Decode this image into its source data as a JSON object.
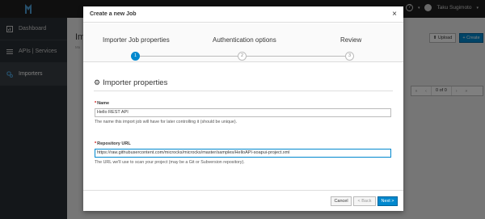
{
  "topbar": {
    "help": "?",
    "user": "Taku Sugimoto"
  },
  "sidebar": {
    "items": [
      {
        "label": "Dashboard"
      },
      {
        "label": "APIs | Services"
      },
      {
        "label": "Importers"
      }
    ]
  },
  "background": {
    "title": "Im",
    "subtitle": "Ma",
    "upload_label": "Upload",
    "create_label": "+ Create",
    "pager_count": "0 of 0"
  },
  "modal": {
    "title": "Create a new Job",
    "close": "×",
    "steps": [
      {
        "label": "Importer Job properties",
        "number": "1"
      },
      {
        "label": "Authentication options",
        "number": "2"
      },
      {
        "label": "Review",
        "number": "3"
      }
    ],
    "section_title": "Importer properties",
    "name": {
      "label": "Name",
      "value": "Hello REST API",
      "help": "The name this import job will have for later controlling it (should be unique)."
    },
    "repo": {
      "label": "Repository URL",
      "value": "https://raw.githubusercontent.com/microcks/microcks/master/samples/HelloAPI-soapui-project.xml",
      "help": "The URL we'll use to scan your project (may be a Git or Subversion repository)."
    },
    "footer": {
      "cancel": "Cancel",
      "back": "< Back",
      "next": "Next >"
    }
  },
  "colors": {
    "accent": "#0088ce",
    "sidebar": "#292e34",
    "topbar": "#1f1f1f"
  }
}
